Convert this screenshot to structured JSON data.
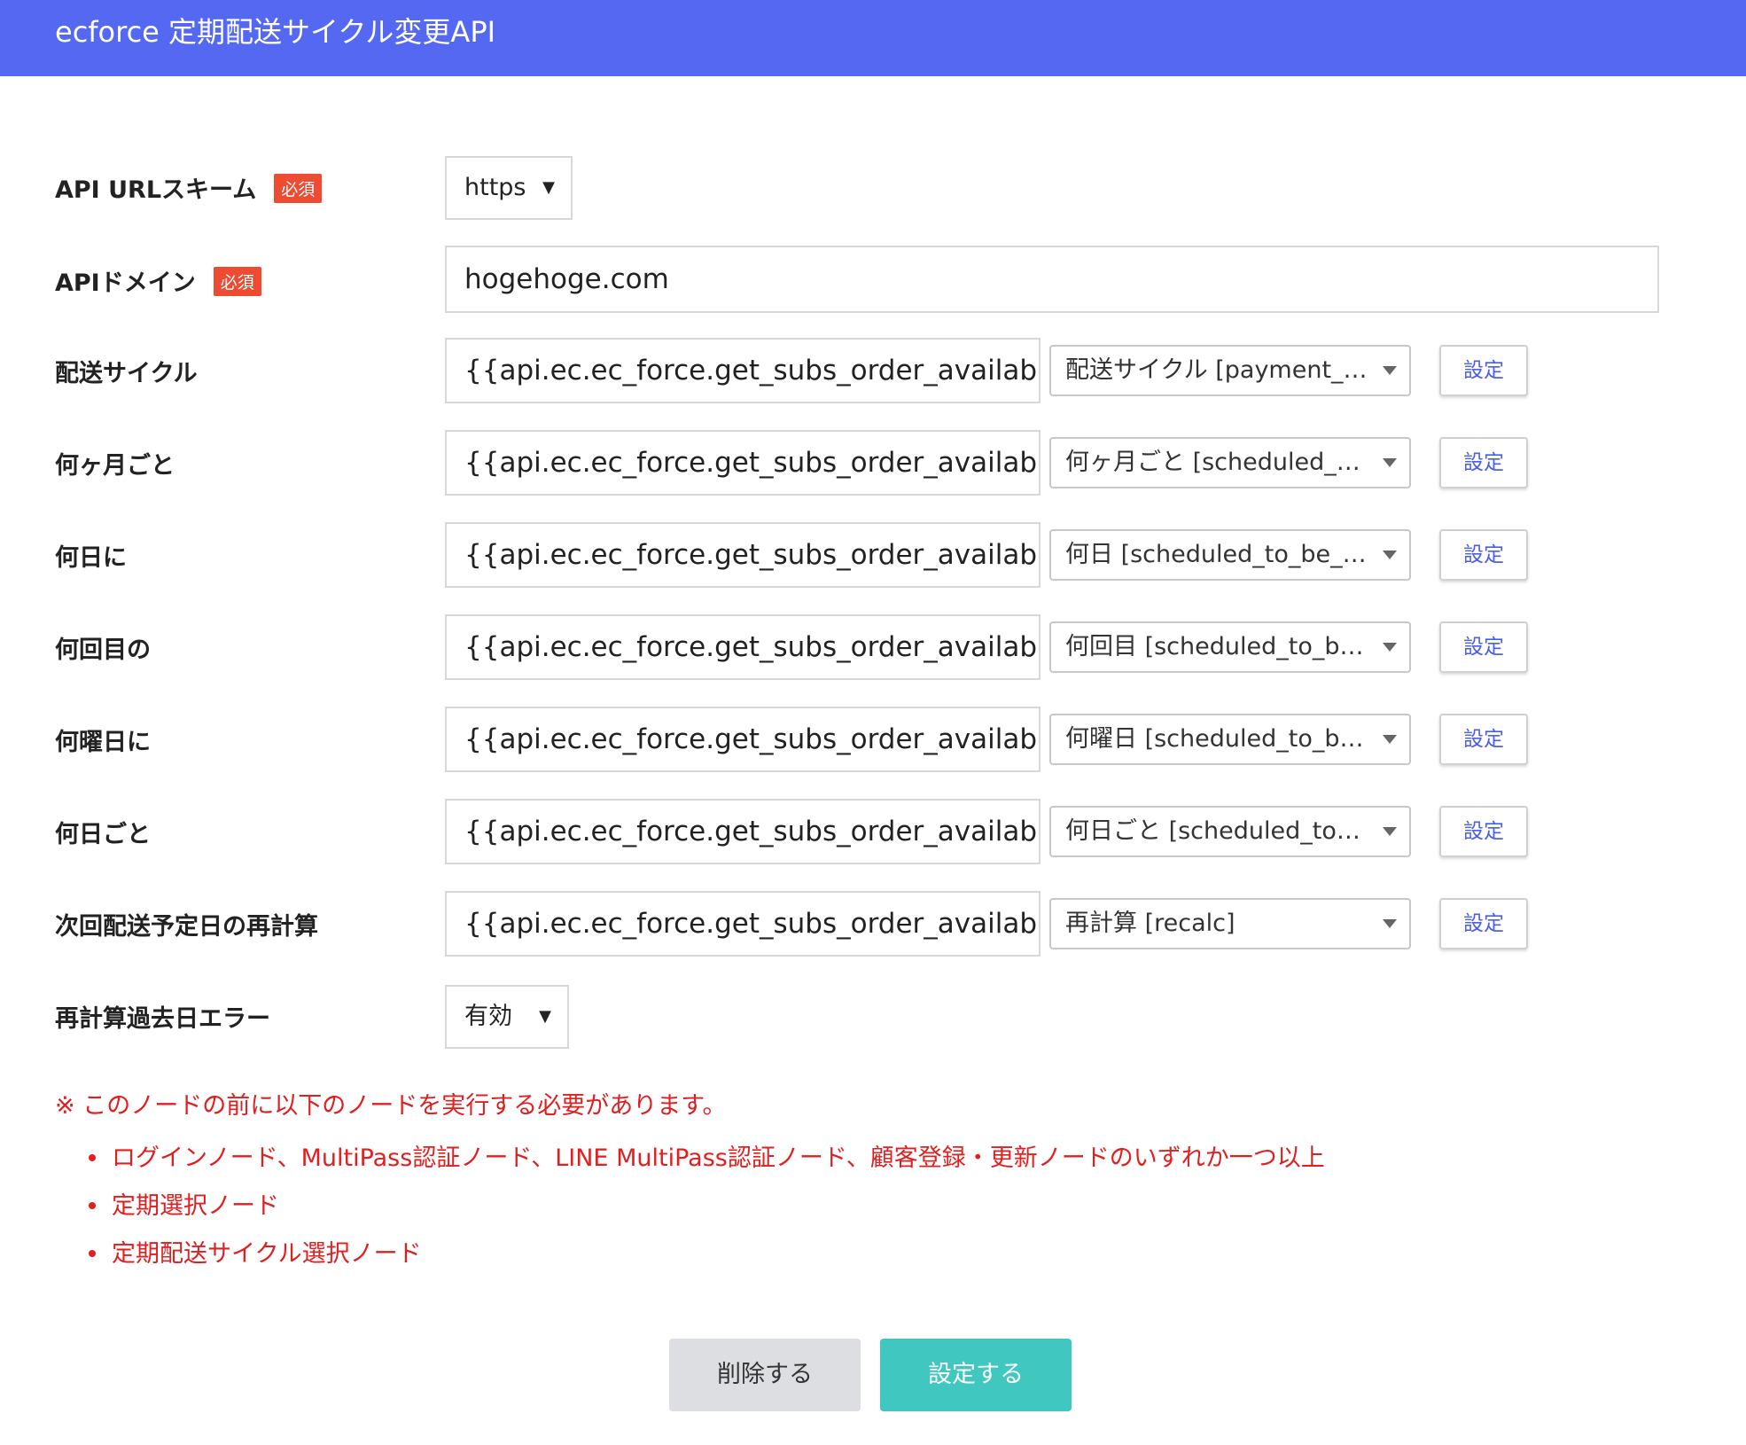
{
  "header": {
    "title": "ecforce 定期配送サイクル変更API"
  },
  "required_badge": "必須",
  "scheme": {
    "label": "API URLスキーム",
    "value": "https",
    "arrow": "▼"
  },
  "domain": {
    "label": "APIドメイン",
    "value": "hogehoge.com"
  },
  "mapping_rows": [
    {
      "label": "配送サイクル",
      "value": "{{api.ec.ec_force.get_subs_order_available_",
      "select": "配送サイクル [payment_…",
      "button": "設定"
    },
    {
      "label": "何ヶ月ごと",
      "value": "{{api.ec.ec_force.get_subs_order_available_",
      "select": "何ヶ月ごと [scheduled_…",
      "button": "設定"
    },
    {
      "label": "何日に",
      "value": "{{api.ec.ec_force.get_subs_order_available_",
      "select": "何日 [scheduled_to_be_…",
      "button": "設定"
    },
    {
      "label": "何回目の",
      "value": "{{api.ec.ec_force.get_subs_order_available_",
      "select": "何回目 [scheduled_to_b…",
      "button": "設定"
    },
    {
      "label": "何曜日に",
      "value": "{{api.ec.ec_force.get_subs_order_available_",
      "select": "何曜日 [scheduled_to_b…",
      "button": "設定"
    },
    {
      "label": "何日ごと",
      "value": "{{api.ec.ec_force.get_subs_order_available_",
      "select": "何日ごと [scheduled_to…",
      "button": "設定"
    },
    {
      "label": "次回配送予定日の再計算",
      "value": "{{api.ec.ec_force.get_subs_order_available_",
      "select": "再計算 [recalc]",
      "button": "設定"
    }
  ],
  "past_date_error": {
    "label": "再計算過去日エラー",
    "value": "有効",
    "arrow": "▼"
  },
  "notice": {
    "text": "※ このノードの前に以下のノードを実行する必要があります。",
    "items": [
      "ログインノード、MultiPass認証ノード、LINE MultiPass認証ノード、顧客登録・更新ノードのいずれか一つ以上",
      "定期選択ノード",
      "定期配送サイクル選択ノード"
    ]
  },
  "footer": {
    "delete_label": "削除する",
    "submit_label": "設定する"
  }
}
